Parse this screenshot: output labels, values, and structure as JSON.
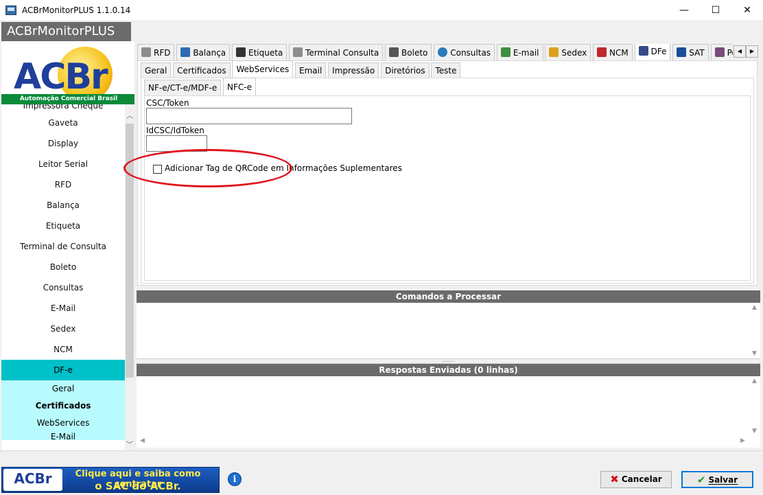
{
  "window": {
    "title": "ACBrMonitorPLUS 1.1.0.14",
    "min": "—",
    "max": "☐",
    "close": "✕"
  },
  "app_header": "ACBrMonitorPLUS",
  "logo": {
    "text": "ACBr",
    "subtitle": "Automação Comercial Brasil"
  },
  "sidebar": {
    "items": [
      "Impressora Cheque",
      "Gaveta",
      "Display",
      "Leitor Serial",
      "RFD",
      "Balança",
      "Etiqueta",
      "Terminal de Consulta",
      "Boleto",
      "Consultas",
      "E-Mail",
      "Sedex",
      "NCM",
      "DF-e"
    ],
    "sub_items": [
      "Geral",
      "Certificados",
      "WebServices",
      "E-Mail"
    ],
    "scroll_up": "︿",
    "scroll_down": "﹀"
  },
  "main_tabs": [
    {
      "label": "RFD",
      "color": "#8c8c8c"
    },
    {
      "label": "Balança",
      "color": "#2b6cb0"
    },
    {
      "label": "Etiqueta",
      "color": "#333333"
    },
    {
      "label": "Terminal Consulta",
      "color": "#8c8c8c"
    },
    {
      "label": "Boleto",
      "color": "#555555"
    },
    {
      "label": "Consultas",
      "color": "#2a7ab8"
    },
    {
      "label": "E-mail",
      "color": "#3f8f3f"
    },
    {
      "label": "Sedex",
      "color": "#d9a31a"
    },
    {
      "label": "NCM",
      "color": "#c0282d"
    },
    {
      "label": "DFe",
      "color": "#334a8c"
    },
    {
      "label": "SAT",
      "color": "#1a4d99"
    },
    {
      "label": "Po",
      "color": "#7a4a7a"
    }
  ],
  "tab_arrows": {
    "left": "◀",
    "right": "▶"
  },
  "dfe_tabs": [
    "Geral",
    "Certificados",
    "WebServices",
    "Email",
    "Impressão",
    "Diretórios",
    "Teste"
  ],
  "ws_tabs": [
    "NF-e/CT-e/MDF-e",
    "NFC-e"
  ],
  "nfce": {
    "csc_label": "CSC/Token",
    "idcsc_label": "IdCSC/IdToken",
    "csc_value": "",
    "idcsc_value": "",
    "qrcode_checkbox_label": "Adicionar Tag de QRCode em Informações Suplementares",
    "qrcode_checked": false
  },
  "panels": {
    "commands_title": "Comandos a Processar",
    "responses_title": "Respostas Enviadas (0 linhas)",
    "splitter_grip": "......",
    "scroll_up": "▲",
    "scroll_down": "▼",
    "scroll_left": "◀",
    "scroll_right": "▶"
  },
  "bottom": {
    "sac_logo": "ACBr",
    "sac_line1": "Clique aqui e saiba como contratar",
    "sac_line2": "o SAC do ACBr.",
    "info": "i",
    "cancel_label": "Cancelar",
    "save_label": "Salvar",
    "cancel_icon": "✖",
    "save_icon": "✔"
  },
  "colors": {
    "header_gray": "#6b6b6b",
    "active_item": "#00c0c8",
    "sub_item_bg": "#b8fbff",
    "highlight_ellipse": "#e0141e"
  }
}
